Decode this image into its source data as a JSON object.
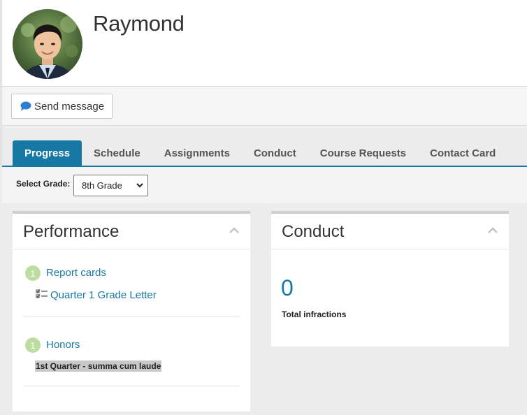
{
  "student": {
    "name": "Raymond"
  },
  "actions": {
    "send_message": "Send message"
  },
  "tabs": [
    {
      "label": "Progress",
      "active": true
    },
    {
      "label": "Schedule",
      "active": false
    },
    {
      "label": "Assignments",
      "active": false
    },
    {
      "label": "Conduct",
      "active": false
    },
    {
      "label": "Course Requests",
      "active": false
    },
    {
      "label": "Contact Card",
      "active": false
    }
  ],
  "grade_selector": {
    "label": "Select Grade:",
    "selected": "8th Grade"
  },
  "performance": {
    "title": "Performance",
    "report_cards": {
      "count": "1",
      "label": "Report cards",
      "items": [
        "Quarter 1 Grade Letter"
      ]
    },
    "honors": {
      "count": "1",
      "label": "Honors",
      "items": [
        "1st Quarter - summa cum laude"
      ]
    }
  },
  "conduct": {
    "title": "Conduct",
    "count": "0",
    "label": "Total infractions"
  },
  "colors": {
    "accent": "#1778a3",
    "badge": "#bcdca0",
    "message_icon": "#2e7fd1"
  },
  "icons": {
    "send_message": "speech-bubble-icon",
    "report_item": "checklist-icon",
    "collapse": "chevron-up-icon",
    "select": "chevron-down-icon"
  }
}
